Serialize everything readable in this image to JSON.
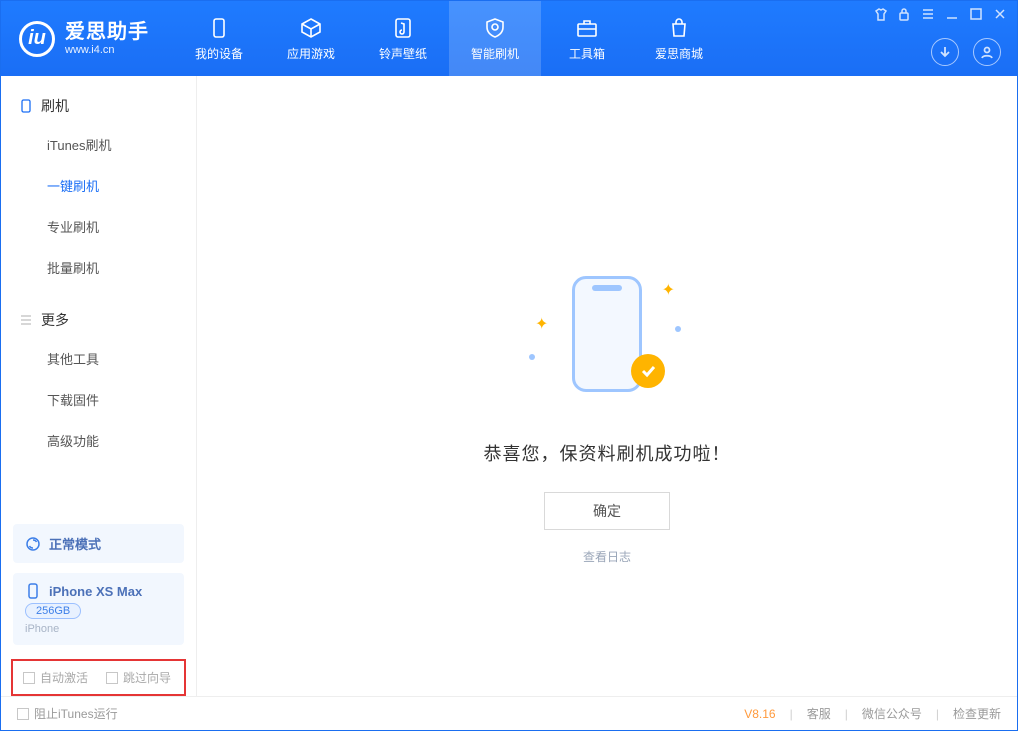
{
  "brand": {
    "name": "爱思助手",
    "url": "www.i4.cn"
  },
  "topTabs": [
    {
      "label": "我的设备",
      "icon": "device-icon"
    },
    {
      "label": "应用游戏",
      "icon": "cube-icon"
    },
    {
      "label": "铃声壁纸",
      "icon": "note-icon"
    },
    {
      "label": "智能刷机",
      "icon": "shield-icon",
      "active": true
    },
    {
      "label": "工具箱",
      "icon": "toolbox-icon"
    },
    {
      "label": "爱思商城",
      "icon": "bag-icon"
    }
  ],
  "sidebar": {
    "group1": {
      "title": "刷机",
      "items": [
        "iTunes刷机",
        "一键刷机",
        "专业刷机",
        "批量刷机"
      ],
      "activeIndex": 1
    },
    "group2": {
      "title": "更多",
      "items": [
        "其他工具",
        "下载固件",
        "高级功能"
      ]
    }
  },
  "modeCard": {
    "label": "正常模式"
  },
  "deviceCard": {
    "name": "iPhone XS Max",
    "capacity": "256GB",
    "type": "iPhone"
  },
  "bottomChecks": {
    "autoActivate": "自动激活",
    "skipGuide": "跳过向导"
  },
  "main": {
    "successText": "恭喜您，保资料刷机成功啦！",
    "okButton": "确定",
    "logLink": "查看日志"
  },
  "footer": {
    "blockItunes": "阻止iTunes运行",
    "version": "V8.16",
    "links": [
      "客服",
      "微信公众号",
      "检查更新"
    ]
  }
}
